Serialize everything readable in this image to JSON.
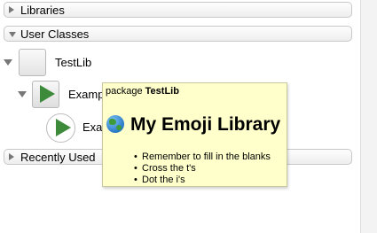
{
  "sections": {
    "libraries": "Libraries",
    "user_classes": "User Classes",
    "recently_used": "Recently Used"
  },
  "tree": {
    "library_label": "TestLib",
    "class_label": "Examp",
    "instance_label": "Exam"
  },
  "tooltip": {
    "package_prefix": "package",
    "package_name": "TestLib",
    "title": "My Emoji Library",
    "title_icon": "globe-emoji",
    "bullets": [
      "Remember to fill in the blanks",
      "Cross the t's",
      "Dot the i's"
    ]
  },
  "colors": {
    "tooltip_bg": "#ffffcc",
    "play_green": "#3c8a3a"
  }
}
